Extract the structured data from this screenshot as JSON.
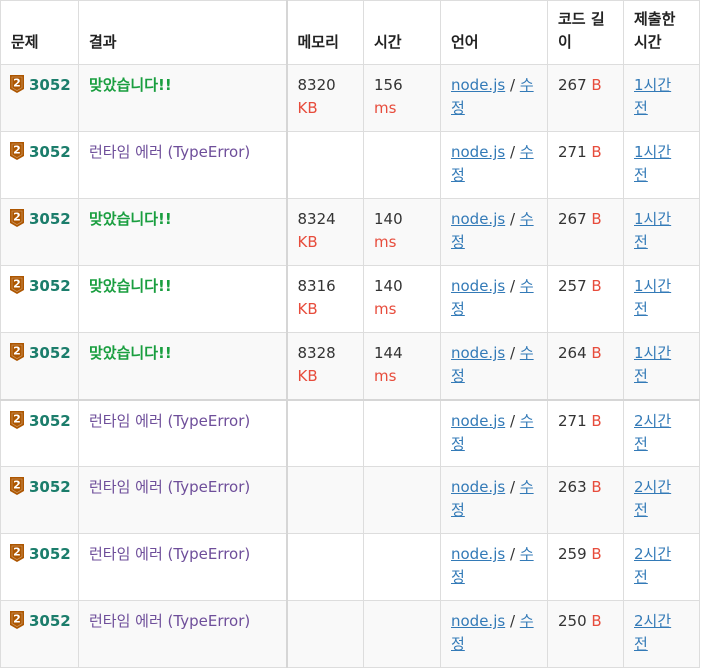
{
  "headers": {
    "problem": "문제",
    "result": "결과",
    "memory": "메모리",
    "time": "시간",
    "language": "언어",
    "code_length": "코드 길이",
    "submitted": "제출한 시간"
  },
  "tier_badge": {
    "icon": "bronze-tier-2-icon",
    "label": "2",
    "color": "#ad5600"
  },
  "rows": [
    {
      "problem": "3052",
      "result": "맞았습니다!!",
      "status": "accepted",
      "memory": "8320",
      "memory_unit": "KB",
      "time": "156",
      "time_unit": "ms",
      "lang": "node.js",
      "sep": "/",
      "edit": "수정",
      "length": "267",
      "length_unit": "B",
      "submitted": "1시간 전"
    },
    {
      "problem": "3052",
      "result": "런타임 에러 (TypeError)",
      "status": "runtime-error",
      "memory": "",
      "memory_unit": "",
      "time": "",
      "time_unit": "",
      "lang": "node.js",
      "sep": "/",
      "edit": "수정",
      "length": "271",
      "length_unit": "B",
      "submitted": "1시간 전"
    },
    {
      "problem": "3052",
      "result": "맞았습니다!!",
      "status": "accepted",
      "memory": "8324",
      "memory_unit": "KB",
      "time": "140",
      "time_unit": "ms",
      "lang": "node.js",
      "sep": "/",
      "edit": "수정",
      "length": "267",
      "length_unit": "B",
      "submitted": "1시간 전"
    },
    {
      "problem": "3052",
      "result": "맞았습니다!!",
      "status": "accepted",
      "memory": "8316",
      "memory_unit": "KB",
      "time": "140",
      "time_unit": "ms",
      "lang": "node.js",
      "sep": "/",
      "edit": "수정",
      "length": "257",
      "length_unit": "B",
      "submitted": "1시간 전"
    },
    {
      "problem": "3052",
      "result": "맞았습니다!!",
      "status": "accepted",
      "memory": "8328",
      "memory_unit": "KB",
      "time": "144",
      "time_unit": "ms",
      "lang": "node.js",
      "sep": "/",
      "edit": "수정",
      "length": "264",
      "length_unit": "B",
      "submitted": "1시간 전"
    },
    {
      "problem": "3052",
      "result": "런타임 에러 (TypeError)",
      "status": "runtime-error",
      "memory": "",
      "memory_unit": "",
      "time": "",
      "time_unit": "",
      "lang": "node.js",
      "sep": "/",
      "edit": "수정",
      "length": "271",
      "length_unit": "B",
      "submitted": "2시간 전"
    },
    {
      "problem": "3052",
      "result": "런타임 에러 (TypeError)",
      "status": "runtime-error",
      "memory": "",
      "memory_unit": "",
      "time": "",
      "time_unit": "",
      "lang": "node.js",
      "sep": "/",
      "edit": "수정",
      "length": "263",
      "length_unit": "B",
      "submitted": "2시간 전"
    },
    {
      "problem": "3052",
      "result": "런타임 에러 (TypeError)",
      "status": "runtime-error",
      "memory": "",
      "memory_unit": "",
      "time": "",
      "time_unit": "",
      "lang": "node.js",
      "sep": "/",
      "edit": "수정",
      "length": "259",
      "length_unit": "B",
      "submitted": "2시간 전"
    },
    {
      "problem": "3052",
      "result": "런타임 에러 (TypeError)",
      "status": "runtime-error",
      "memory": "",
      "memory_unit": "",
      "time": "",
      "time_unit": "",
      "lang": "node.js",
      "sep": "/",
      "edit": "수정",
      "length": "250",
      "length_unit": "B",
      "submitted": "2시간 전"
    }
  ]
}
